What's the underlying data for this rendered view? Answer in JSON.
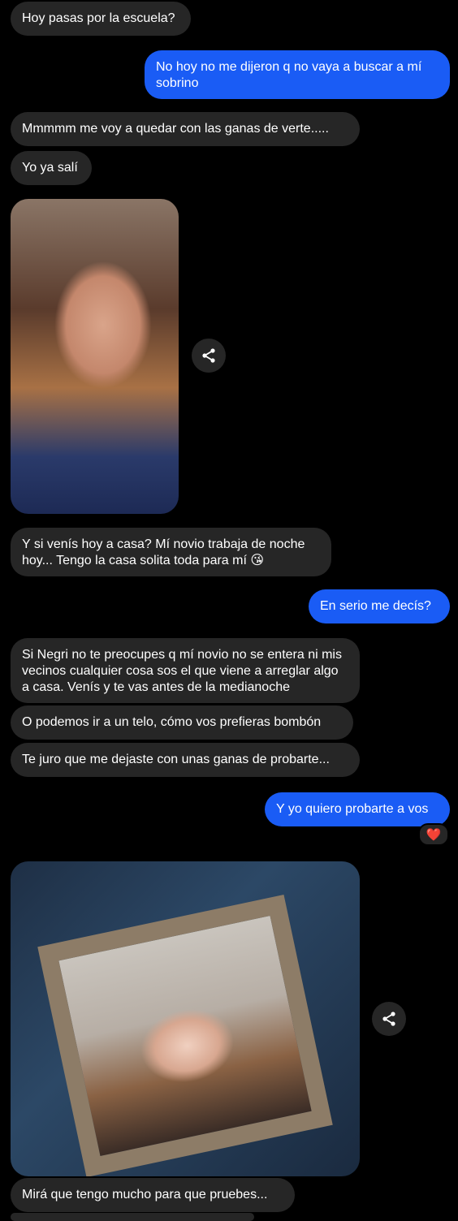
{
  "messages": [
    {
      "direction": "incoming",
      "text": "Hoy pasas por la escuela?"
    },
    {
      "direction": "outgoing",
      "text": "No hoy no me dijeron q no vaya a buscar a mí sobrino"
    },
    {
      "direction": "incoming",
      "text": "Mmmmm me voy a quedar con las ganas de verte....."
    },
    {
      "direction": "incoming",
      "text": "Yo ya salí"
    },
    {
      "direction": "incoming",
      "type": "photo"
    },
    {
      "direction": "incoming",
      "text": "Y si venís hoy a casa? Mí novio trabaja de noche hoy... Tengo la casa solita toda para mí 😘"
    },
    {
      "direction": "outgoing",
      "text": "En serio me decís?"
    },
    {
      "direction": "incoming",
      "text": "Si Negri no te preocupes q mí novio no se entera ni mis vecinos cualquier cosa sos el que viene a arreglar algo a casa. Venís y te vas antes de la medianoche"
    },
    {
      "direction": "incoming",
      "text": "O podemos ir a un telo, cómo vos prefieras bombón"
    },
    {
      "direction": "incoming",
      "text": "Te juro que me dejaste con unas ganas de probarte..."
    },
    {
      "direction": "outgoing",
      "text": "Y yo quiero probarte a vos",
      "reaction": "❤️"
    },
    {
      "direction": "incoming",
      "type": "photo"
    },
    {
      "direction": "incoming",
      "text": "Mirá que tengo mucho para que pruebes..."
    }
  ],
  "icons": {
    "share": "share-icon",
    "reaction": "heart-icon"
  },
  "colors": {
    "background": "#000000",
    "incoming_bubble": "#262626",
    "outgoing_bubble": "#1a5cf5",
    "text": "#ffffff",
    "heart": "#ff2d3a"
  }
}
